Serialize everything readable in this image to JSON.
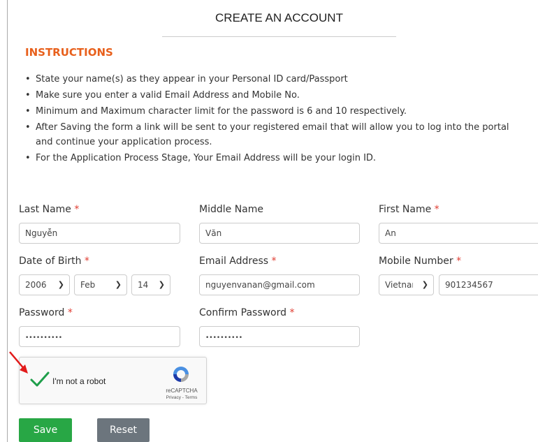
{
  "title": "CREATE AN ACCOUNT",
  "instructions": {
    "heading": "INSTRUCTIONS",
    "items": [
      "State your name(s) as they appear in your Personal ID card/Passport",
      "Make sure you enter a valid Email Address and Mobile No.",
      "Minimum and Maximum character limit for the password is 6 and 10 respectively.",
      "After Saving the form a link will be sent to your registered email that will allow you to log into the portal and continue your application process.",
      "For the Application Process Stage, Your Email Address will be your login ID."
    ]
  },
  "form": {
    "last_name": {
      "label": "Last Name",
      "value": "Nguyễn"
    },
    "middle_name": {
      "label": "Middle Name",
      "value": "Văn"
    },
    "first_name": {
      "label": "First Name",
      "value": "An"
    },
    "dob": {
      "label": "Date of Birth",
      "year": "2006",
      "month": "Feb",
      "day": "14"
    },
    "email": {
      "label": "Email Address",
      "value": "nguyenvanan@gmail.com"
    },
    "mobile": {
      "label": "Mobile Number",
      "country": "Vietnam",
      "value": "901234567"
    },
    "password": {
      "label": "Password",
      "value": "••••••••••"
    },
    "confirm_password": {
      "label": "Confirm Password",
      "value": "••••••••••"
    },
    "required_mark": "*"
  },
  "captcha": {
    "label": "I'm not a robot",
    "brand": "reCAPTCHA",
    "links": "Privacy - Terms",
    "checked": true
  },
  "buttons": {
    "save": "Save",
    "reset": "Reset"
  },
  "colors": {
    "accent_orange": "#e8601c",
    "required_red": "#e03c31",
    "save_green": "#28a745",
    "reset_gray": "#6c757d",
    "check_green": "#1e9e4a",
    "arrow_red": "#e21b1b"
  }
}
